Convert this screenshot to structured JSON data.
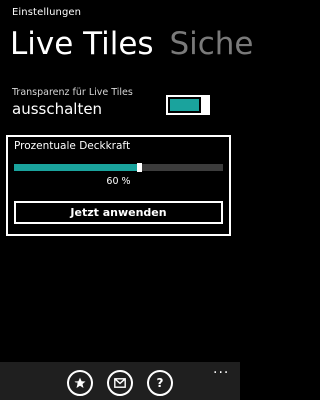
{
  "app": {
    "title": "Einstellungen"
  },
  "pivot": {
    "items": [
      {
        "label": "Live Tiles",
        "active": true
      },
      {
        "label": "Siche",
        "active": false
      }
    ]
  },
  "transparency": {
    "caption": "Transparenz für Live Tiles",
    "value_label": "ausschalten",
    "toggle_on": true
  },
  "opacity": {
    "title": "Prozentuale Deckkraft",
    "value_percent": 60,
    "value_text": "60 %",
    "apply_label": "Jetzt anwenden"
  },
  "colors": {
    "accent": "#1aa39d",
    "background": "#000000",
    "text": "#ffffff",
    "inactive_text": "#7a7a7a",
    "appbar": "#1f1f1f"
  },
  "appbar": {
    "buttons": [
      {
        "icon": "star-icon"
      },
      {
        "icon": "mail-icon"
      },
      {
        "icon": "help-icon",
        "glyph": "?"
      }
    ],
    "more_glyph": "..."
  }
}
